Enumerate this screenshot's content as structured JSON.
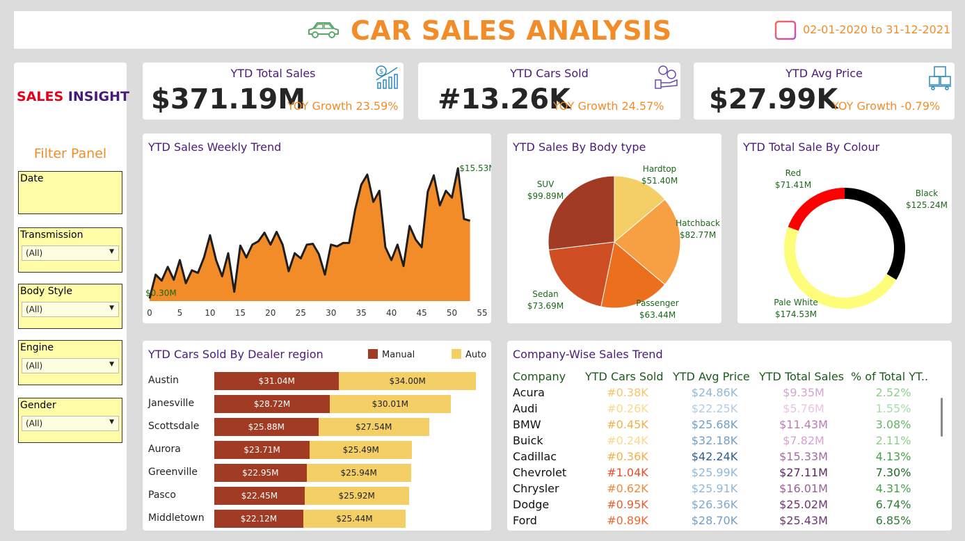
{
  "header": {
    "title": "CAR SALES ANALYSIS",
    "date_range": "02-01-2020 to 31-12-2021",
    "car_icon": "car-icon",
    "calendar_icon": "calendar-icon"
  },
  "sidebar": {
    "brand_part1": "SALES",
    "brand_part2": "INSIGHT",
    "filter_title": "Filter Panel",
    "filters": [
      {
        "label": "Date",
        "value": ""
      },
      {
        "label": "Transmission",
        "value": "(All)"
      },
      {
        "label": "Body Style",
        "value": "(All)"
      },
      {
        "label": "Engine",
        "value": "(All)"
      },
      {
        "label": "Gender",
        "value": "(All)"
      }
    ]
  },
  "kpis": [
    {
      "title": "YTD Total Sales",
      "value": "$371.19M",
      "growth": "YOY Growth 23.59%",
      "icon": "sales-growth-icon"
    },
    {
      "title": "YTD Cars Sold",
      "value": "#13.26K",
      "growth": "YOY Growth 24.57%",
      "icon": "cars-sold-icon"
    },
    {
      "title": "YTD Avg Price",
      "value": "$27.99K",
      "growth": "YOY Growth -0.79%",
      "icon": "avg-price-icon"
    }
  ],
  "colors": {
    "accent": "#f28c28",
    "title_purple": "#4a1a7a",
    "manual": "#a23b24",
    "auto": "#f3cf65"
  },
  "charts": {
    "weekly": {
      "title": "YTD Sales Weekly Trend",
      "max_label": "$15.53M",
      "min_label": "$0.30M"
    },
    "body": {
      "title": "YTD Sales By Body type"
    },
    "colour": {
      "title": "YTD Total Sale By Colour"
    },
    "dealer": {
      "title": "YTD Cars Sold By Dealer region"
    },
    "company": {
      "title": "Company-Wise Sales Trend"
    }
  },
  "chart_data": [
    {
      "type": "area",
      "title": "YTD Sales Weekly Trend",
      "x": [
        0,
        1,
        2,
        3,
        4,
        5,
        6,
        7,
        8,
        9,
        10,
        11,
        12,
        13,
        14,
        15,
        16,
        17,
        18,
        19,
        20,
        21,
        22,
        23,
        24,
        25,
        26,
        27,
        28,
        29,
        30,
        31,
        32,
        33,
        34,
        35,
        36,
        37,
        38,
        39,
        40,
        41,
        42,
        43,
        44,
        45,
        46,
        47,
        48,
        49,
        50,
        51,
        52,
        53
      ],
      "y": [
        0.3,
        3.1,
        2.4,
        4.0,
        2.5,
        4.8,
        2.1,
        3.6,
        3.3,
        5.1,
        7.7,
        4.8,
        2.9,
        5.6,
        1.1,
        6.5,
        5.1,
        6.6,
        7.0,
        8.0,
        6.6,
        8.1,
        6.6,
        3.5,
        5.6,
        5.0,
        6.6,
        6.7,
        5.5,
        3.1,
        6.6,
        6.4,
        6.8,
        6.8,
        10.7,
        13.6,
        14.8,
        11.6,
        12.9,
        6.3,
        4.8,
        6.6,
        4.1,
        8.8,
        7.2,
        6.3,
        12.8,
        14.7,
        11.2,
        12.9,
        12.1,
        15.53,
        9.6,
        9.4
      ],
      "xlim": [
        0,
        55
      ],
      "xticks": [
        0,
        5,
        10,
        15,
        20,
        25,
        30,
        35,
        40,
        45,
        50,
        55
      ],
      "annotations": [
        "$15.53M",
        "$0.30M"
      ]
    },
    {
      "type": "pie",
      "title": "YTD Sales By Body type",
      "categories": [
        "Hardtop",
        "Hatchback",
        "Passenger",
        "Sedan",
        "SUV"
      ],
      "values": [
        51.4,
        82.77,
        63.44,
        73.69,
        99.89
      ],
      "value_labels": [
        "$51.40M",
        "$82.77M",
        "$63.44M",
        "$73.69M",
        "$99.89M"
      ],
      "colors": [
        "#f3cf65",
        "#f6a043",
        "#ec6f1e",
        "#cf4e24",
        "#a23b24"
      ]
    },
    {
      "type": "pie",
      "title": "YTD Total Sale By Colour",
      "categories": [
        "Black",
        "Pale White",
        "Red"
      ],
      "values": [
        125.24,
        174.53,
        71.41
      ],
      "value_labels": [
        "$125.24M",
        "$174.53M",
        "$71.41M"
      ],
      "colors": [
        "#000000",
        "#fdfd7a",
        "#ff0000"
      ]
    },
    {
      "type": "bar",
      "title": "YTD Cars Sold By Dealer region",
      "categories": [
        "Austin",
        "Janesville",
        "Scottsdale",
        "Aurora",
        "Greenville",
        "Pasco",
        "Middletown"
      ],
      "series": [
        {
          "name": "Manual",
          "values": [
            31.04,
            28.72,
            25.88,
            23.71,
            22.95,
            22.45,
            22.12
          ],
          "labels": [
            "$31.04M",
            "$28.72M",
            "$25.88M",
            "$23.71M",
            "$22.95M",
            "$22.45M",
            "$22.12M"
          ]
        },
        {
          "name": "Auto",
          "values": [
            34.0,
            30.01,
            27.54,
            25.49,
            25.94,
            25.92,
            25.44
          ],
          "labels": [
            "$34.00M",
            "$30.01M",
            "$27.54M",
            "$25.49M",
            "$25.94M",
            "$25.92M",
            "$25.44M"
          ]
        }
      ]
    },
    {
      "type": "table",
      "title": "Company-Wise Sales Trend",
      "columns": [
        "Company",
        "YTD Cars Sold",
        "YTD Avg Price",
        "YTD Total Sales",
        "% of Total YT.."
      ],
      "rows": [
        [
          "Acura",
          "#0.38K",
          "$24.86K",
          "$9.35M",
          "2.52%"
        ],
        [
          "Audi",
          "#0.26K",
          "$22.25K",
          "$5.76M",
          "1.55%"
        ],
        [
          "BMW",
          "#0.45K",
          "$25.68K",
          "$11.43M",
          "3.08%"
        ],
        [
          "Buick",
          "#0.24K",
          "$32.18K",
          "$7.82M",
          "2.11%"
        ],
        [
          "Cadillac",
          "#0.36K",
          "$42.24K",
          "$15.33M",
          "4.13%"
        ],
        [
          "Chevrolet",
          "#1.04K",
          "$25.99K",
          "$27.11M",
          "7.30%"
        ],
        [
          "Chrysler",
          "#0.62K",
          "$25.91K",
          "$16.01M",
          "4.31%"
        ],
        [
          "Dodge",
          "#0.95K",
          "$26.36K",
          "$25.02M",
          "6.74%"
        ],
        [
          "Ford",
          "#0.89K",
          "$28.70K",
          "$25.43M",
          "6.85%"
        ]
      ]
    }
  ]
}
